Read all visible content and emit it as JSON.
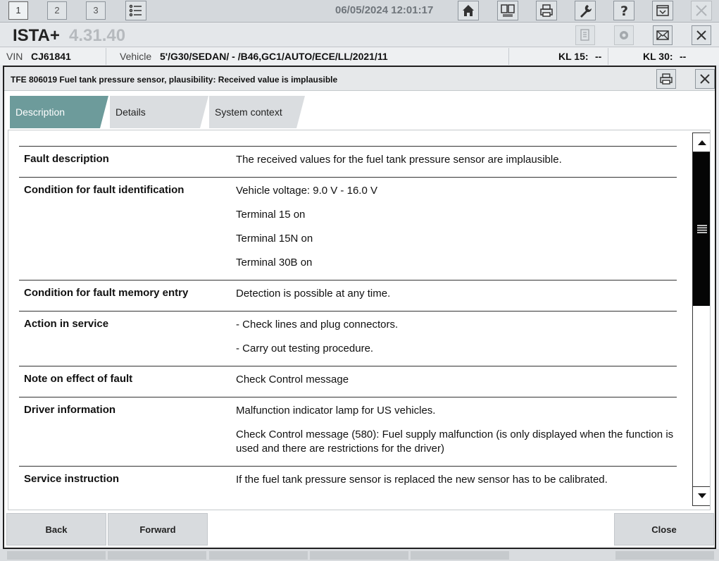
{
  "topbar": {
    "tabs": [
      "1",
      "2",
      "3"
    ],
    "datetime": "06/05/2024 12:01:17",
    "icons": [
      "list-icon",
      "home-icon",
      "compare-icon",
      "print-icon",
      "wrench-icon",
      "help-icon",
      "download-icon",
      "close-icon"
    ]
  },
  "app": {
    "name": "ISTA+",
    "version": "4.31.40",
    "icons": [
      "document-icon",
      "gear-icon",
      "mail-icon",
      "close-icon"
    ]
  },
  "vehicle": {
    "vin_label": "VIN",
    "vin": "CJ61841",
    "vehicle_label": "Vehicle",
    "vehicle": "5'/G30/SEDAN/ - /B46,GC1/AUTO/ECE/LL/2021/11",
    "kl15_label": "KL 15:",
    "kl15": "--",
    "kl30_label": "KL 30:",
    "kl30": "--"
  },
  "dialog": {
    "title": "TFE 806019 Fuel tank pressure sensor, plausibility: Received value is implausible",
    "tabs": [
      {
        "label": "Description",
        "active": true
      },
      {
        "label": "Details",
        "active": false
      },
      {
        "label": "System context",
        "active": false
      }
    ],
    "rows": [
      {
        "key": "Fault description",
        "values": [
          "The received values for the fuel tank pressure sensor are implausible."
        ]
      },
      {
        "key": "Condition for fault identification",
        "values": [
          "Vehicle voltage: 9.0 V - 16.0 V",
          "Terminal 15 on",
          "Terminal 15N on",
          "Terminal 30B on"
        ]
      },
      {
        "key": "Condition for fault memory entry",
        "values": [
          "Detection is possible at any time."
        ]
      },
      {
        "key": "Action in service",
        "values": [
          "- Check lines and plug connectors.",
          "- Carry out testing procedure."
        ]
      },
      {
        "key": "Note on effect of fault",
        "values": [
          "Check Control message"
        ]
      },
      {
        "key": "Driver information",
        "values": [
          "Malfunction indicator lamp for US vehicles.",
          "Check Control message (580): Fuel supply malfunction (is only displayed when the function is used and there are restrictions for the driver)"
        ]
      },
      {
        "key": "Service instruction",
        "values": [
          "If the fuel tank pressure sensor is replaced the new sensor has to be calibrated."
        ]
      }
    ],
    "buttons": {
      "back": "Back",
      "forward": "Forward",
      "close": "Close"
    }
  },
  "colors": {
    "active_tab": "#6d9b9b",
    "scroll_thumb": "#050505"
  }
}
